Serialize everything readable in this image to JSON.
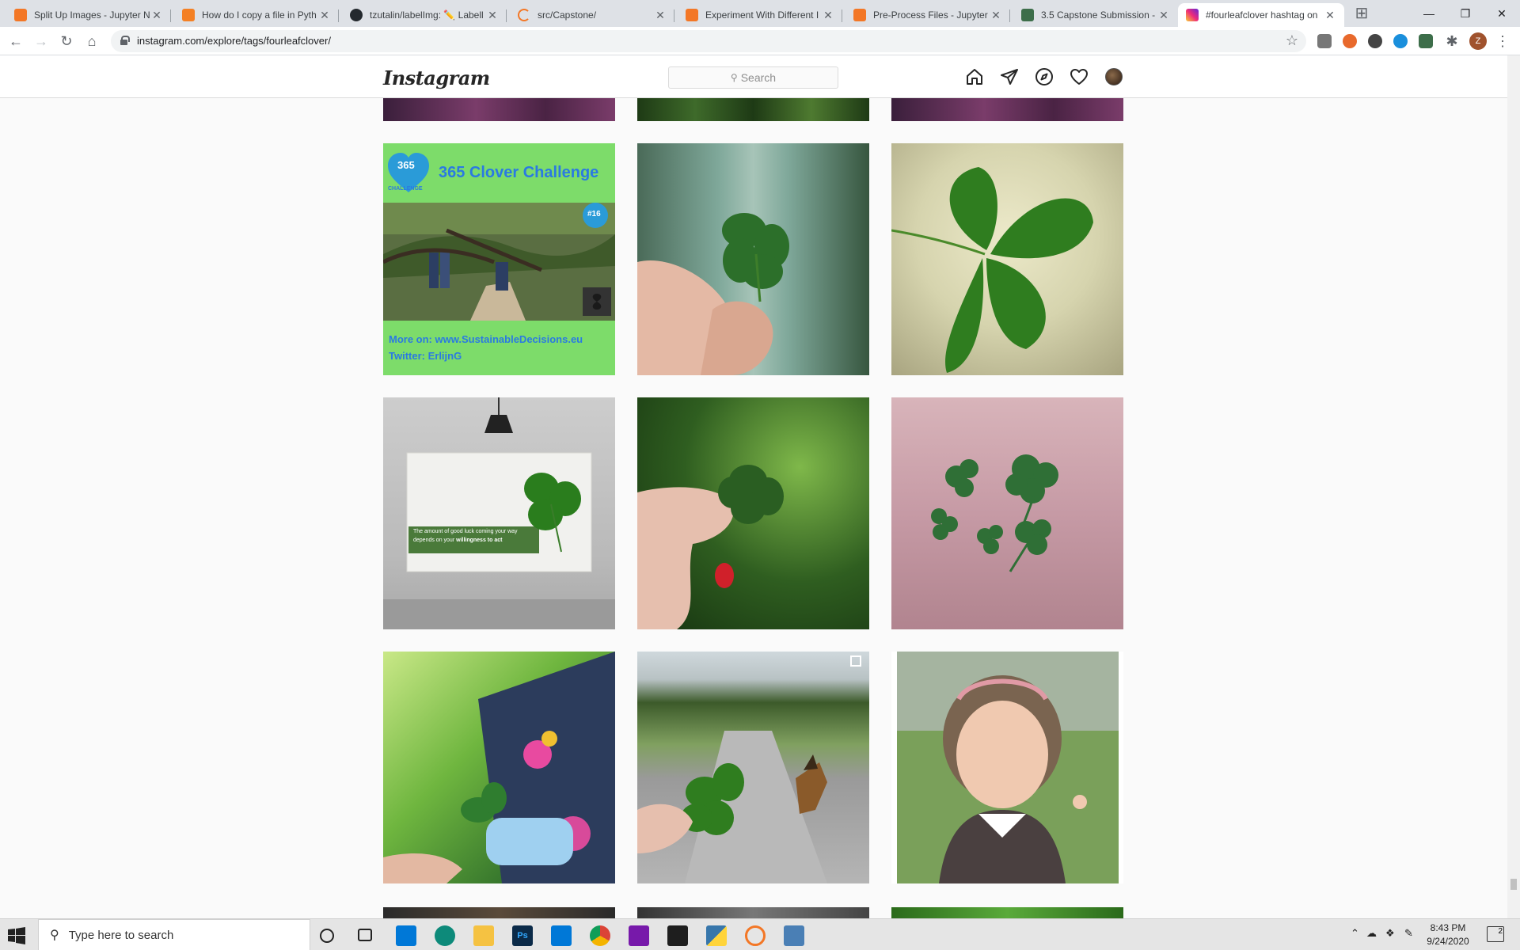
{
  "browser": {
    "tabs": [
      {
        "title": "Split Up Images - Jupyter N",
        "favicon": "jupyter-icon"
      },
      {
        "title": "How do I copy a file in Pyth",
        "favicon": "stackoverflow-icon"
      },
      {
        "title": "tzutalin/labelImg: ✏️ Labell",
        "favicon": "github-icon"
      },
      {
        "title": "src/Capstone/",
        "favicon": "jupyter-loading-icon"
      },
      {
        "title": "Experiment With Different I",
        "favicon": "jupyter-icon"
      },
      {
        "title": "Pre-Process Files - Jupyter I",
        "favicon": "jupyter-icon"
      },
      {
        "title": "3.5 Capstone Submission -",
        "favicon": "springboard-icon"
      },
      {
        "title": "#fourleafclover hashtag on",
        "favicon": "instagram-icon"
      }
    ],
    "url": "instagram.com/explore/tags/fourleafclover/",
    "profile_initial": "Z"
  },
  "instagram": {
    "logo": "Instagram",
    "search_placeholder": "Search",
    "grid_images": [
      {
        "desc": "365 clover challenge post"
      },
      {
        "desc": "hand holding four leaf clover, blurred background"
      },
      {
        "desc": "large four leaf clover close-up"
      },
      {
        "desc": "poster with lamp and clover quote"
      },
      {
        "desc": "fingers with red nails holding clover"
      },
      {
        "desc": "palm with several four leaf clovers"
      },
      {
        "desc": "hand holding clover near stroller toys"
      },
      {
        "desc": "clover held in front of german shepherd on path"
      },
      {
        "desc": "smiling girl holding tiny clover"
      }
    ],
    "tile1": {
      "badge": "365",
      "badge_sub": "CHALLENGE",
      "title": "365 Clover Challenge",
      "tag": "#16",
      "line1": "More on: www.SustainableDecisions.eu",
      "line2": "Twitter: ErlijnG"
    },
    "tile4": {
      "quote_line1": "The amount of good luck coming your way",
      "quote_line2": "depends on your",
      "quote_bold": "willingness to act"
    }
  },
  "taskbar": {
    "search_placeholder": "Type here to search",
    "time": "8:43 PM",
    "date": "9/24/2020",
    "notifications": "2"
  },
  "colors": {
    "accent": "#0078d7",
    "ig_border": "#dbdbdb",
    "clover_green": "#2f7d1f",
    "challenge_bg": "#7ddc6a",
    "challenge_text": "#2a7ae2"
  }
}
